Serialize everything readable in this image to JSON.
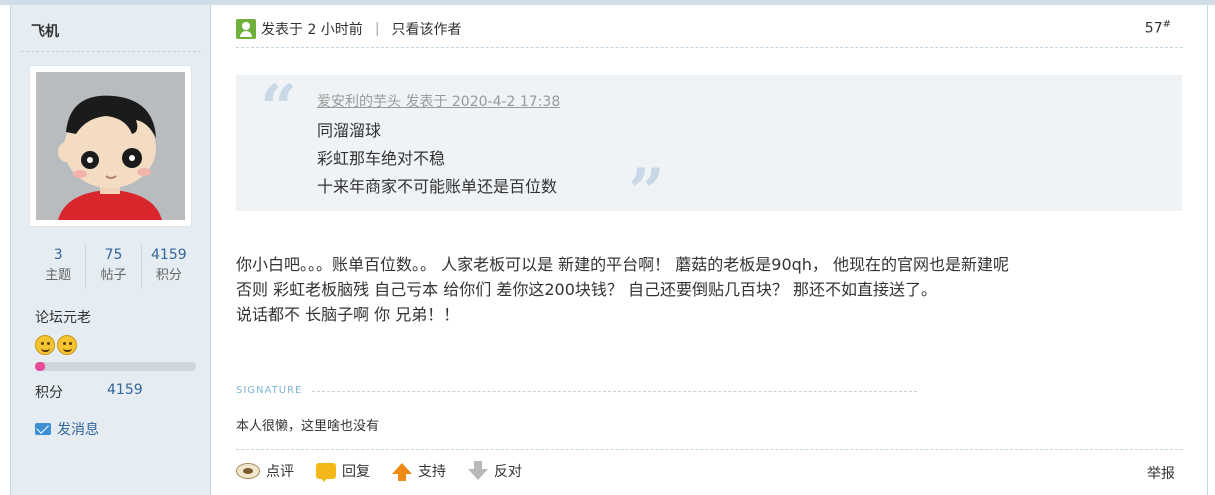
{
  "author": {
    "name": "飞机",
    "stats": [
      {
        "num": "3",
        "label": "主题"
      },
      {
        "num": "75",
        "label": "帖子"
      },
      {
        "num": "4159",
        "label": "积分"
      }
    ],
    "rank_title": "论坛元老",
    "rank_icons": [
      "smiley-icon",
      "smiley-icon"
    ],
    "level_progress": 0.06,
    "points_label": "积分",
    "points_value": "4159",
    "message_label": "发消息"
  },
  "post": {
    "posted_time": "发表于 2 小时前",
    "separator": "|",
    "author_only_label": "只看该作者",
    "floor_number": "57",
    "floor_suffix": "#",
    "quote": {
      "author_line": "爱安利的芋头 发表于 2020-4-2 17:38",
      "lines": [
        "同溜溜球",
        "彩虹那车绝对不稳",
        "十来年商家不可能账单还是百位数"
      ]
    },
    "content_lines": [
      "你小白吧。。。账单百位数。。 人家老板可以是 新建的平台啊！ 蘑菇的老板是90qh， 他现在的官网也是新建呢",
      "否则 彩虹老板脑残 自己亏本 给你们 差你这200块钱？ 自己还要倒贴几百块？ 那还不如直接送了。",
      "说话都不 长脑子啊 你 兄弟！！"
    ],
    "signature_label": "SIGNATURE",
    "signature_text": "本人很懒，这里啥也没有"
  },
  "actions": {
    "comment": "点评",
    "reply": "回复",
    "support": "支持",
    "oppose": "反对",
    "report": "举报"
  },
  "colors": {
    "sidebar_bg": "#e5edf2",
    "border": "#c2d5e3",
    "link_blue": "#336699",
    "quote_bg": "#f0f3f6",
    "progress_fill": "#e84d9a"
  }
}
